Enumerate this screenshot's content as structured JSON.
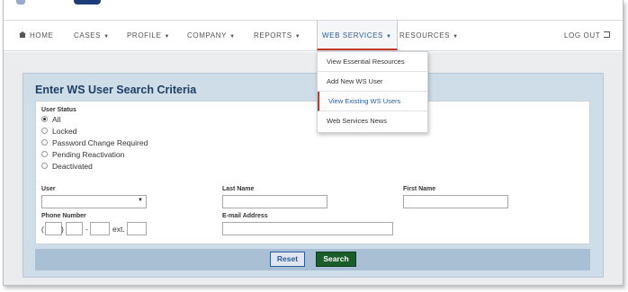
{
  "nav": {
    "home": "HOME",
    "cases": "CASES",
    "profile": "PROFILE",
    "company": "COMPANY",
    "reports": "REPORTS",
    "web_services": "WEB SERVICES",
    "resources": "RESOURCES",
    "logout": "LOG OUT"
  },
  "dropdown": {
    "items": [
      "View Essential Resources",
      "Add New WS User",
      "View Existing WS Users",
      "Web Services News"
    ],
    "selected": "View Existing WS Users"
  },
  "panel": {
    "title": "Enter WS User Search Criteria",
    "user_status_label": "User Status",
    "status_options": [
      "All",
      "Locked",
      "Password Change Required",
      "Pending Reactivation",
      "Deactivated"
    ],
    "selected_status": "All",
    "user_label": "User",
    "last_name_label": "Last Name",
    "first_name_label": "First Name",
    "phone_label": "Phone Number",
    "phone_open_paren": "(",
    "phone_close_paren": ")",
    "phone_dash": "-",
    "phone_ext": "ext.",
    "email_label": "E-mail Address",
    "user_value": "",
    "last_name_value": "",
    "first_name_value": "",
    "email_value": ""
  },
  "buttons": {
    "reset": "Reset",
    "search": "Search"
  },
  "colors": {
    "accent": "#2a5d9a",
    "active_underline": "#c0392b",
    "search_button": "#1a5c2a",
    "panel_bg": "#cfdde9",
    "title": "#1e3f63"
  }
}
